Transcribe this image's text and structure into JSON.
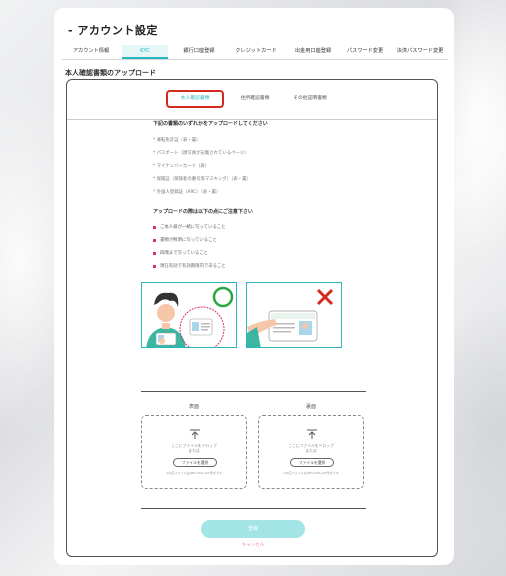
{
  "header": {
    "title": "- アカウント設定"
  },
  "top_tabs": [
    {
      "label": "アカウント情報",
      "active": false
    },
    {
      "label": "KYC",
      "active": true
    },
    {
      "label": "銀行口座登録",
      "active": false
    },
    {
      "label": "クレジットカード",
      "active": false
    },
    {
      "label": "出金用口座登録",
      "active": false
    },
    {
      "label": "パスワード変更",
      "active": false
    },
    {
      "label": "決済パスワード変更",
      "active": false
    }
  ],
  "section": {
    "title": "本人確認書類のアップロード"
  },
  "sub_tabs": [
    {
      "label": "本人確認書類",
      "active": true
    },
    {
      "label": "住所確認書類",
      "active": false
    },
    {
      "label": "その他証明書類",
      "active": false
    }
  ],
  "requirements": {
    "title": "下記の書類のいずれかをアップロードしてください",
    "items": [
      "* 運転免許証（表・裏）",
      "* パスポート（顔写真が記載されているページ）",
      "* マイナンバーカード（表）",
      "* 保険証（保険者の番号等マスキング）（表・裏）",
      "* 外国人登録証（ARC）（表・裏）"
    ]
  },
  "notes": {
    "title": "アップロードの際は以下の点にご注意下さい",
    "items": [
      "ご本人様が一緒に写っていること",
      "書類が鮮明に写っていること",
      "四隅まで写っていること",
      "現在有効で有効期限内であること"
    ],
    "bullet_color": "#d6336c"
  },
  "examples": {
    "good_icon": "check-circle-icon",
    "bad_icon": "x-mark-icon"
  },
  "upload": {
    "front": {
      "label": "表面",
      "drop_text": "ここにファイルをドロップ",
      "or_text": "または",
      "button_label": "ファイルを選択",
      "note": "※対応ファイルはJPEG,PNG,GIF形式です"
    },
    "back": {
      "label": "裏面",
      "drop_text": "ここにファイルをドロップ",
      "or_text": "または",
      "button_label": "ファイルを選択",
      "note": "※対応ファイルはJPEG,PNG,GIF形式です"
    }
  },
  "actions": {
    "submit_label": "登録",
    "cancel_label": "キャンセル"
  },
  "colors": {
    "accent": "#2bb6bf",
    "highlight_border": "#d42a1e",
    "submit_bg": "#a3e4e7",
    "cancel": "#e48aa8"
  }
}
